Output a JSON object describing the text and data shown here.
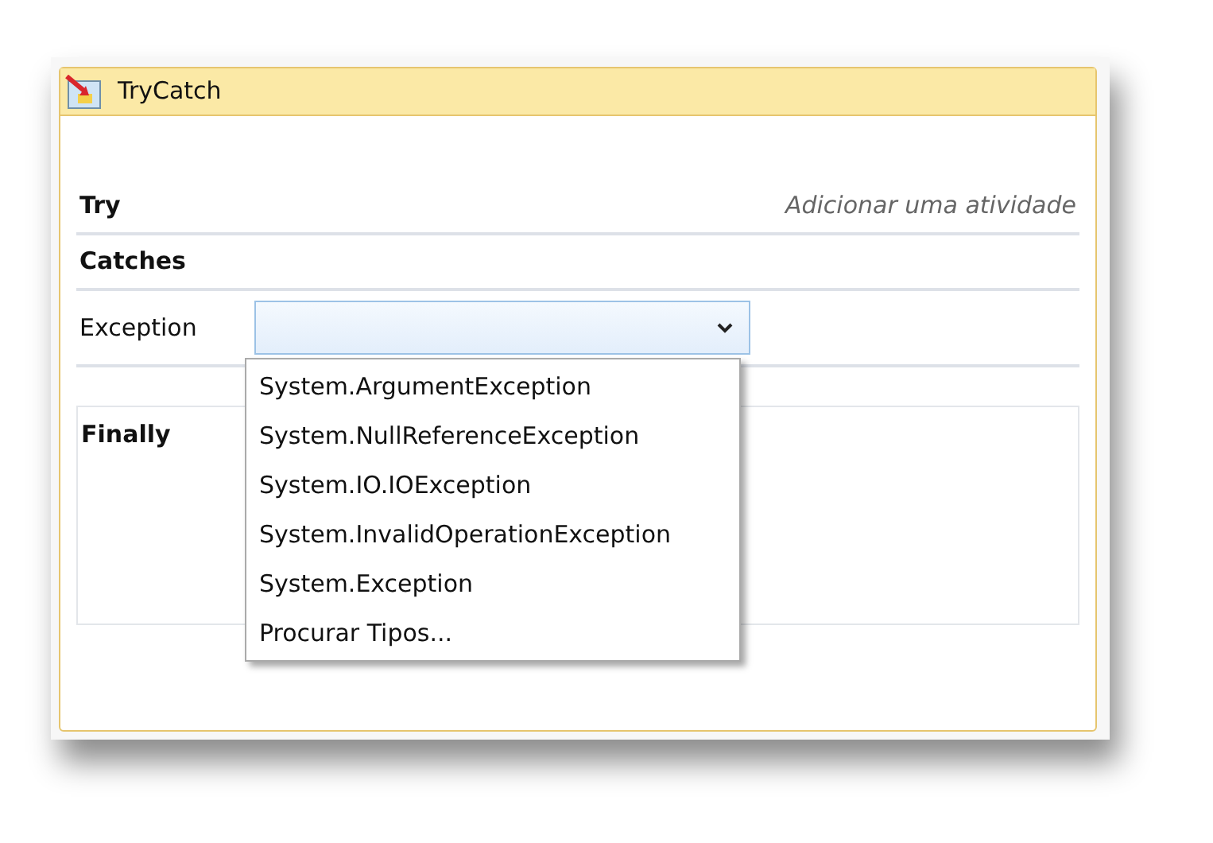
{
  "activity": {
    "title": "TryCatch"
  },
  "try": {
    "label": "Try",
    "placeholder": "Adicionar uma atividade"
  },
  "catches": {
    "label": "Catches",
    "exception_label": "Exception",
    "expanded": true,
    "options": [
      {
        "label": "System.ArgumentException"
      },
      {
        "label": "System.NullReferenceException"
      },
      {
        "label": "System.IO.IOException"
      },
      {
        "label": "System.InvalidOperationException"
      },
      {
        "label": "System.Exception"
      },
      {
        "label": "Procurar Tipos..."
      }
    ]
  },
  "finally": {
    "label": "Finally"
  }
}
